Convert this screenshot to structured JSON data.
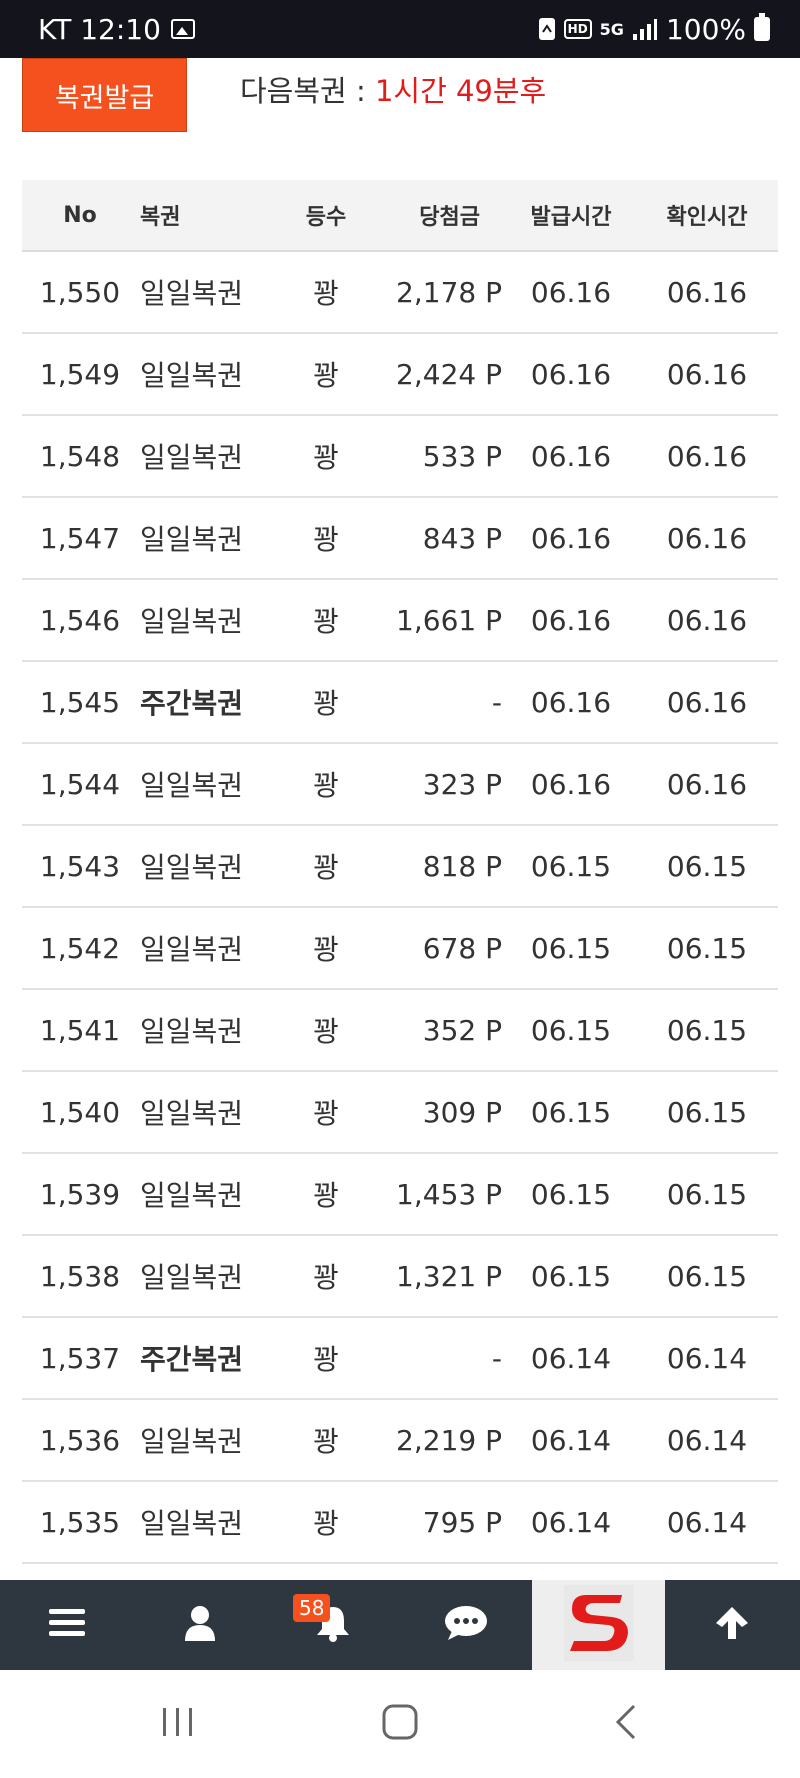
{
  "status_bar": {
    "carrier_time": "KT 12:10",
    "hd_label": "HD",
    "network": "5G",
    "battery": "100%"
  },
  "top": {
    "issue_button": "복권발급",
    "next_label": "다음복권 : ",
    "next_value": "1시간 49분후"
  },
  "table": {
    "headers": {
      "no": "No",
      "type": "복권",
      "rank": "등수",
      "prize": "당첨금",
      "issued": "발급시간",
      "checked": "확인시간"
    },
    "rows": [
      {
        "no": "1,550",
        "type": "일일복권",
        "rank": "꽝",
        "prize": "2,178 P",
        "issued": "06.16",
        "checked": "06.16"
      },
      {
        "no": "1,549",
        "type": "일일복권",
        "rank": "꽝",
        "prize": "2,424 P",
        "issued": "06.16",
        "checked": "06.16"
      },
      {
        "no": "1,548",
        "type": "일일복권",
        "rank": "꽝",
        "prize": "533 P",
        "issued": "06.16",
        "checked": "06.16"
      },
      {
        "no": "1,547",
        "type": "일일복권",
        "rank": "꽝",
        "prize": "843 P",
        "issued": "06.16",
        "checked": "06.16"
      },
      {
        "no": "1,546",
        "type": "일일복권",
        "rank": "꽝",
        "prize": "1,661 P",
        "issued": "06.16",
        "checked": "06.16"
      },
      {
        "no": "1,545",
        "type": "주간복권",
        "rank": "꽝",
        "prize": "-",
        "issued": "06.16",
        "checked": "06.16"
      },
      {
        "no": "1,544",
        "type": "일일복권",
        "rank": "꽝",
        "prize": "323 P",
        "issued": "06.16",
        "checked": "06.16"
      },
      {
        "no": "1,543",
        "type": "일일복권",
        "rank": "꽝",
        "prize": "818 P",
        "issued": "06.15",
        "checked": "06.15"
      },
      {
        "no": "1,542",
        "type": "일일복권",
        "rank": "꽝",
        "prize": "678 P",
        "issued": "06.15",
        "checked": "06.15"
      },
      {
        "no": "1,541",
        "type": "일일복권",
        "rank": "꽝",
        "prize": "352 P",
        "issued": "06.15",
        "checked": "06.15"
      },
      {
        "no": "1,540",
        "type": "일일복권",
        "rank": "꽝",
        "prize": "309 P",
        "issued": "06.15",
        "checked": "06.15"
      },
      {
        "no": "1,539",
        "type": "일일복권",
        "rank": "꽝",
        "prize": "1,453 P",
        "issued": "06.15",
        "checked": "06.15"
      },
      {
        "no": "1,538",
        "type": "일일복권",
        "rank": "꽝",
        "prize": "1,321 P",
        "issued": "06.15",
        "checked": "06.15"
      },
      {
        "no": "1,537",
        "type": "주간복권",
        "rank": "꽝",
        "prize": "-",
        "issued": "06.14",
        "checked": "06.14"
      },
      {
        "no": "1,536",
        "type": "일일복권",
        "rank": "꽝",
        "prize": "2,219 P",
        "issued": "06.14",
        "checked": "06.14"
      },
      {
        "no": "1,535",
        "type": "일일복권",
        "rank": "꽝",
        "prize": "795 P",
        "issued": "06.14",
        "checked": "06.14"
      }
    ]
  },
  "bottom_nav": {
    "notification_count": "58",
    "items": [
      "menu-icon",
      "user-icon",
      "bell-icon",
      "chat-icon",
      "site-logo",
      "arrow-up-icon"
    ]
  },
  "colors": {
    "accent": "#f5511e",
    "highlight_red": "#e21b1b",
    "nav_bg": "#2e3640",
    "status_bar_bg": "#14151c"
  }
}
